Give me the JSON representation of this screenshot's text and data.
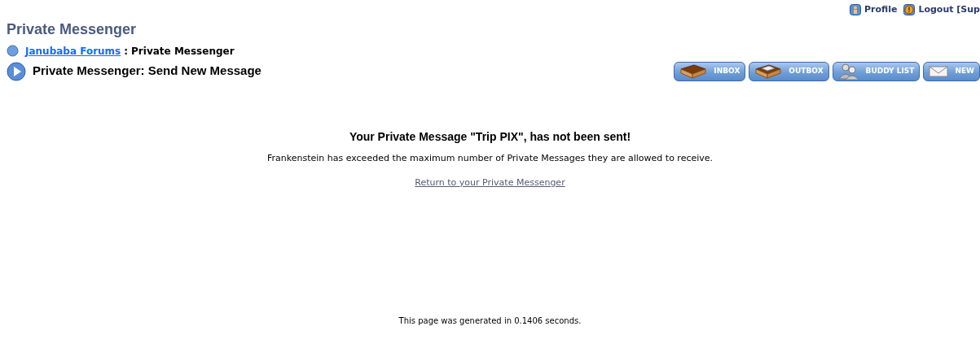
{
  "top_links": [
    {
      "kind": "profile",
      "label": "Profile"
    },
    {
      "kind": "logout",
      "label": "Logout [Sup"
    }
  ],
  "title": "Private Messenger",
  "breadcrumb": {
    "link": "Janubaba Forums",
    "separator": ":",
    "current": "Private Messenger"
  },
  "section_title": "Private Messenger: Send New Message",
  "toolbar": [
    {
      "kind": "inbox",
      "label": "INBOX"
    },
    {
      "kind": "outbox",
      "label": "OUTBOX"
    },
    {
      "kind": "buddy",
      "label": "BUDDY LIST"
    },
    {
      "kind": "new",
      "label": "NEW"
    }
  ],
  "message": {
    "heading": "Your Private Message \"Trip PIX\", has not been sent!",
    "body": "Frankenstein has exceeded the maximum number of Private Messages they are allowed to receive.",
    "link": "Return to your Private Messenger"
  },
  "footer": "This page was generated in 0.1406 seconds."
}
